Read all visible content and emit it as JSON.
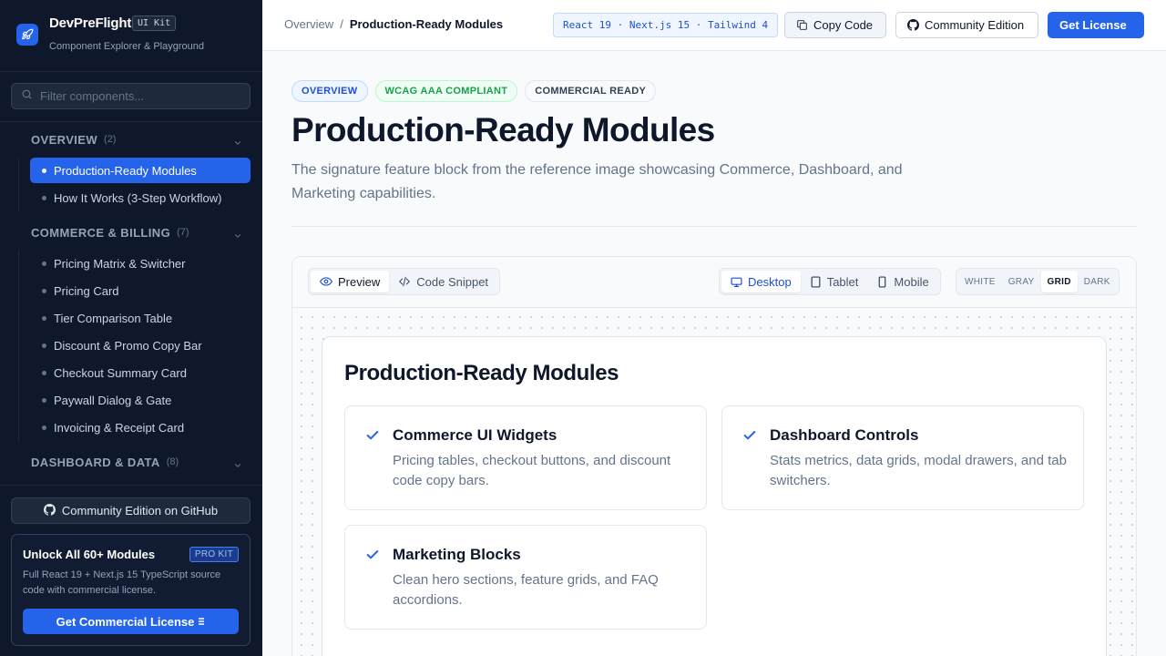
{
  "brand": {
    "name": "DevPreFlight",
    "badge": "UI Kit",
    "subtitle": "Component Explorer & Playground"
  },
  "sidebar": {
    "filter_placeholder": "Filter components...",
    "sections": [
      {
        "title": "OVERVIEW",
        "count": "(2)",
        "items": [
          {
            "label": "Production-Ready Modules",
            "active": true
          },
          {
            "label": "How It Works (3-Step Workflow)",
            "active": false
          }
        ]
      },
      {
        "title": "COMMERCE & BILLING",
        "count": "(7)",
        "items": [
          {
            "label": "Pricing Matrix & Switcher"
          },
          {
            "label": "Pricing Card"
          },
          {
            "label": "Tier Comparison Table"
          },
          {
            "label": "Discount & Promo Copy Bar"
          },
          {
            "label": "Checkout Summary Card"
          },
          {
            "label": "Paywall Dialog & Gate"
          },
          {
            "label": "Invoicing & Receipt Card"
          }
        ]
      },
      {
        "title": "DASHBOARD & DATA",
        "count": "(8)",
        "items": []
      }
    ],
    "github_button": "Community Edition on GitHub",
    "pro": {
      "title": "Unlock All 60+ Modules",
      "badge": "PRO KIT",
      "description": "Full React 19 + Next.js 15 TypeScript source code with commercial license.",
      "cta": "Get Commercial License"
    }
  },
  "topbar": {
    "breadcrumb_root": "Overview",
    "breadcrumb_sep": "/",
    "breadcrumb_current": "Production-Ready Modules",
    "stack": "React 19 · Next.js 15 · Tailwind 4",
    "copy_button": "Copy Code",
    "community_button": "Community Edition",
    "license_button": "Get License"
  },
  "page": {
    "tags": [
      "OVERVIEW",
      "WCAG AAA COMPLIANT",
      "COMMERCIAL READY"
    ],
    "title": "Production-Ready Modules",
    "description": "The signature feature block from the reference image showcasing Commerce, Dashboard, and Marketing capabilities."
  },
  "preview": {
    "modes": [
      "Preview",
      "Code Snippet"
    ],
    "active_mode": "Preview",
    "devices": [
      "Desktop",
      "Tablet",
      "Mobile"
    ],
    "active_device": "Desktop",
    "backgrounds": [
      "WHITE",
      "GRAY",
      "GRID",
      "DARK"
    ],
    "active_background": "GRID",
    "frame_title": "Production-Ready Modules",
    "features": [
      {
        "title": "Commerce UI Widgets",
        "description": "Pricing tables, checkout buttons, and discount code copy bars."
      },
      {
        "title": "Dashboard Controls",
        "description": "Stats metrics, data grids, modal drawers, and tab switchers."
      },
      {
        "title": "Marketing Blocks",
        "description": "Clean hero sections, feature grids, and FAQ accordions."
      }
    ]
  },
  "colors": {
    "accent": "#2563eb",
    "sidebar_bg": "#0f172a",
    "success": "#16a34a"
  }
}
